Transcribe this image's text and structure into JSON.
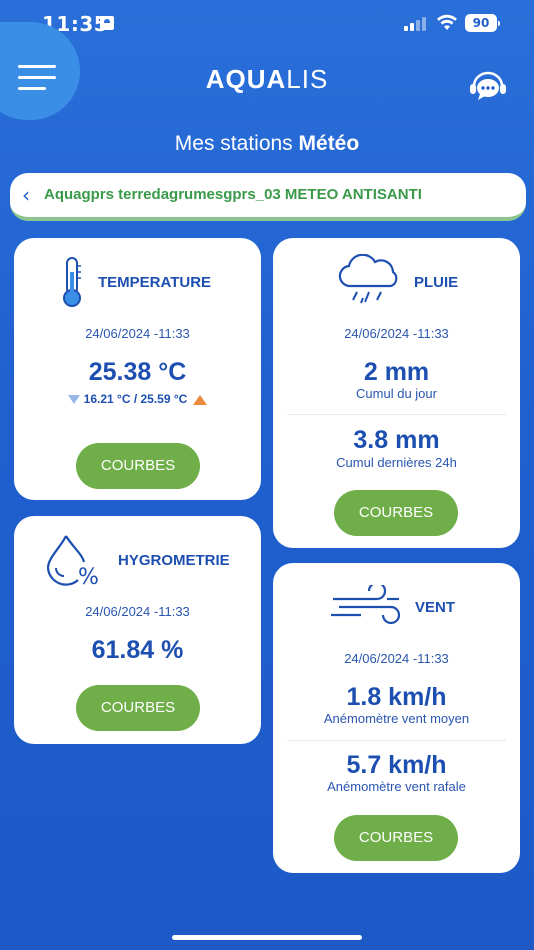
{
  "status_bar": {
    "time": "11:35",
    "battery": "90"
  },
  "header": {
    "logo_bold": "AQUA",
    "logo_thin": "LIS"
  },
  "page": {
    "title_prefix": "Mes stations ",
    "title_bold": "Météo"
  },
  "station": {
    "name": "Aquagprs terredagrumesgprs_03 METEO ANTISANTI"
  },
  "cards": {
    "temperature": {
      "title": "TEMPERATURE",
      "date": "24/06/2024 -11:33",
      "value": "25.38 °C",
      "minmax": "16.21 °C / 25.59 °C",
      "button": "COURBES"
    },
    "pluie": {
      "title": "PLUIE",
      "date": "24/06/2024 -11:33",
      "value1": "2 mm",
      "label1": "Cumul du jour",
      "value2": "3.8 mm",
      "label2": "Cumul dernières 24h",
      "button": "COURBES"
    },
    "hygrometrie": {
      "title": "HYGROMETRIE",
      "date": "24/06/2024 -11:33",
      "value": "61.84 %",
      "button": "COURBES"
    },
    "vent": {
      "title": "VENT",
      "date": "24/06/2024 -11:33",
      "value1": "1.8 km/h",
      "label1": "Anémomètre vent moyen",
      "value2": "5.7 km/h",
      "label2": "Anémomètre vent rafale",
      "button": "COURBES"
    }
  },
  "colors": {
    "accent_blue": "#1d5ac8",
    "button_green": "#6fae48",
    "station_green": "#3a9a4a"
  },
  "icons": [
    "menu-icon",
    "chat-support-icon",
    "thermometer-icon",
    "rain-cloud-icon",
    "humidity-drop-icon",
    "wind-icon"
  ]
}
